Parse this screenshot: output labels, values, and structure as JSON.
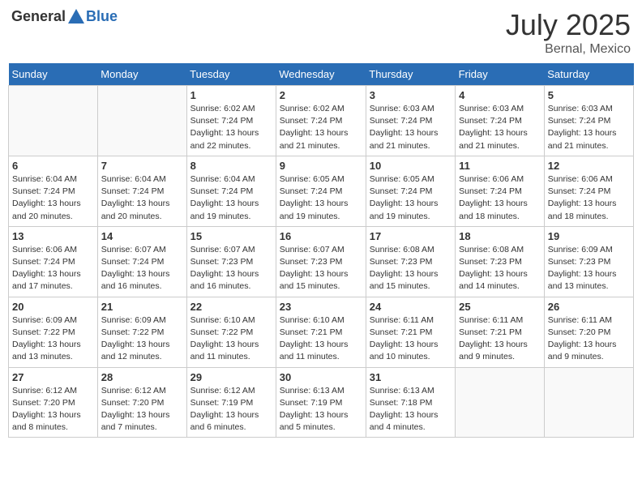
{
  "header": {
    "logo_general": "General",
    "logo_blue": "Blue",
    "month": "July 2025",
    "location": "Bernal, Mexico"
  },
  "days_of_week": [
    "Sunday",
    "Monday",
    "Tuesday",
    "Wednesday",
    "Thursday",
    "Friday",
    "Saturday"
  ],
  "weeks": [
    [
      {
        "day": "",
        "info": ""
      },
      {
        "day": "",
        "info": ""
      },
      {
        "day": "1",
        "info": "Sunrise: 6:02 AM\nSunset: 7:24 PM\nDaylight: 13 hours and 22 minutes."
      },
      {
        "day": "2",
        "info": "Sunrise: 6:02 AM\nSunset: 7:24 PM\nDaylight: 13 hours and 21 minutes."
      },
      {
        "day": "3",
        "info": "Sunrise: 6:03 AM\nSunset: 7:24 PM\nDaylight: 13 hours and 21 minutes."
      },
      {
        "day": "4",
        "info": "Sunrise: 6:03 AM\nSunset: 7:24 PM\nDaylight: 13 hours and 21 minutes."
      },
      {
        "day": "5",
        "info": "Sunrise: 6:03 AM\nSunset: 7:24 PM\nDaylight: 13 hours and 21 minutes."
      }
    ],
    [
      {
        "day": "6",
        "info": "Sunrise: 6:04 AM\nSunset: 7:24 PM\nDaylight: 13 hours and 20 minutes."
      },
      {
        "day": "7",
        "info": "Sunrise: 6:04 AM\nSunset: 7:24 PM\nDaylight: 13 hours and 20 minutes."
      },
      {
        "day": "8",
        "info": "Sunrise: 6:04 AM\nSunset: 7:24 PM\nDaylight: 13 hours and 19 minutes."
      },
      {
        "day": "9",
        "info": "Sunrise: 6:05 AM\nSunset: 7:24 PM\nDaylight: 13 hours and 19 minutes."
      },
      {
        "day": "10",
        "info": "Sunrise: 6:05 AM\nSunset: 7:24 PM\nDaylight: 13 hours and 19 minutes."
      },
      {
        "day": "11",
        "info": "Sunrise: 6:06 AM\nSunset: 7:24 PM\nDaylight: 13 hours and 18 minutes."
      },
      {
        "day": "12",
        "info": "Sunrise: 6:06 AM\nSunset: 7:24 PM\nDaylight: 13 hours and 18 minutes."
      }
    ],
    [
      {
        "day": "13",
        "info": "Sunrise: 6:06 AM\nSunset: 7:24 PM\nDaylight: 13 hours and 17 minutes."
      },
      {
        "day": "14",
        "info": "Sunrise: 6:07 AM\nSunset: 7:24 PM\nDaylight: 13 hours and 16 minutes."
      },
      {
        "day": "15",
        "info": "Sunrise: 6:07 AM\nSunset: 7:23 PM\nDaylight: 13 hours and 16 minutes."
      },
      {
        "day": "16",
        "info": "Sunrise: 6:07 AM\nSunset: 7:23 PM\nDaylight: 13 hours and 15 minutes."
      },
      {
        "day": "17",
        "info": "Sunrise: 6:08 AM\nSunset: 7:23 PM\nDaylight: 13 hours and 15 minutes."
      },
      {
        "day": "18",
        "info": "Sunrise: 6:08 AM\nSunset: 7:23 PM\nDaylight: 13 hours and 14 minutes."
      },
      {
        "day": "19",
        "info": "Sunrise: 6:09 AM\nSunset: 7:23 PM\nDaylight: 13 hours and 13 minutes."
      }
    ],
    [
      {
        "day": "20",
        "info": "Sunrise: 6:09 AM\nSunset: 7:22 PM\nDaylight: 13 hours and 13 minutes."
      },
      {
        "day": "21",
        "info": "Sunrise: 6:09 AM\nSunset: 7:22 PM\nDaylight: 13 hours and 12 minutes."
      },
      {
        "day": "22",
        "info": "Sunrise: 6:10 AM\nSunset: 7:22 PM\nDaylight: 13 hours and 11 minutes."
      },
      {
        "day": "23",
        "info": "Sunrise: 6:10 AM\nSunset: 7:21 PM\nDaylight: 13 hours and 11 minutes."
      },
      {
        "day": "24",
        "info": "Sunrise: 6:11 AM\nSunset: 7:21 PM\nDaylight: 13 hours and 10 minutes."
      },
      {
        "day": "25",
        "info": "Sunrise: 6:11 AM\nSunset: 7:21 PM\nDaylight: 13 hours and 9 minutes."
      },
      {
        "day": "26",
        "info": "Sunrise: 6:11 AM\nSunset: 7:20 PM\nDaylight: 13 hours and 9 minutes."
      }
    ],
    [
      {
        "day": "27",
        "info": "Sunrise: 6:12 AM\nSunset: 7:20 PM\nDaylight: 13 hours and 8 minutes."
      },
      {
        "day": "28",
        "info": "Sunrise: 6:12 AM\nSunset: 7:20 PM\nDaylight: 13 hours and 7 minutes."
      },
      {
        "day": "29",
        "info": "Sunrise: 6:12 AM\nSunset: 7:19 PM\nDaylight: 13 hours and 6 minutes."
      },
      {
        "day": "30",
        "info": "Sunrise: 6:13 AM\nSunset: 7:19 PM\nDaylight: 13 hours and 5 minutes."
      },
      {
        "day": "31",
        "info": "Sunrise: 6:13 AM\nSunset: 7:18 PM\nDaylight: 13 hours and 4 minutes."
      },
      {
        "day": "",
        "info": ""
      },
      {
        "day": "",
        "info": ""
      }
    ]
  ]
}
